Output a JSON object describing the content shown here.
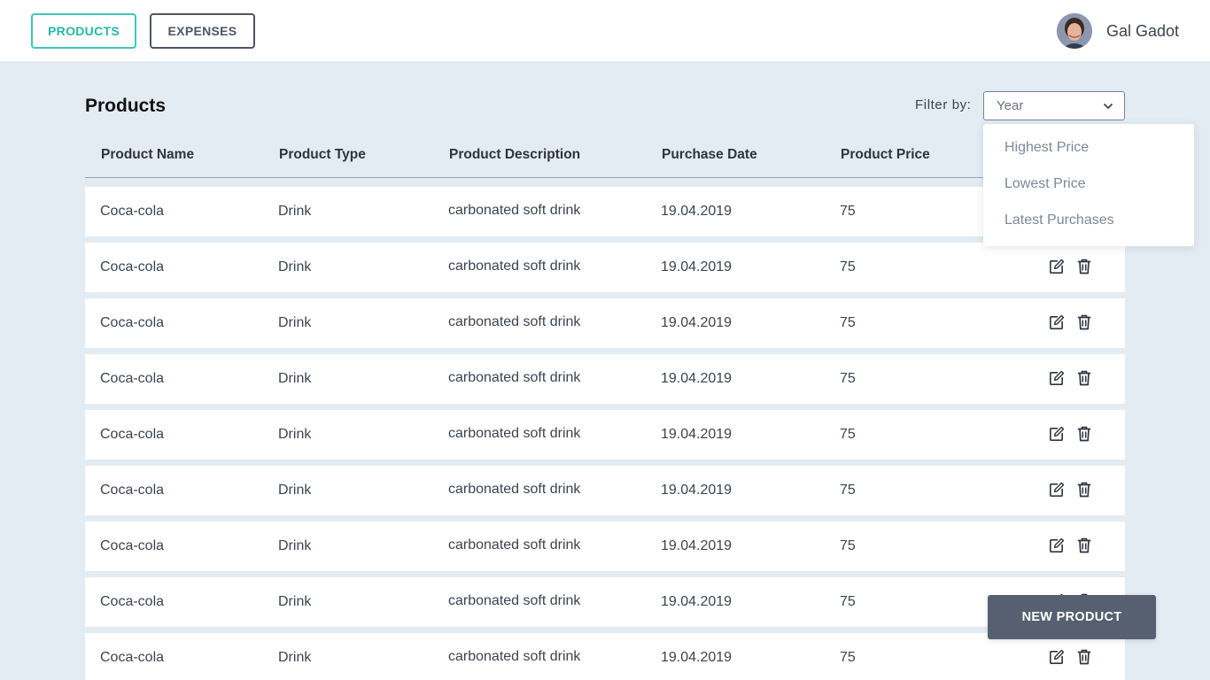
{
  "nav": {
    "products_label": "PRODUCTS",
    "expenses_label": "EXPENSES"
  },
  "user": {
    "name": "Gal Gadot"
  },
  "page": {
    "title": "Products"
  },
  "filter": {
    "label": "Filter by:",
    "selected": "Year",
    "options": [
      "Highest Price",
      "Lowest Price",
      "Latest Purchases"
    ]
  },
  "table": {
    "columns": [
      "Product Name",
      "Product Type",
      "Product Description",
      "Purchase Date",
      "Product Price"
    ],
    "rows": [
      [
        "Coca-cola",
        "Drink",
        "carbonated soft drink",
        "19.04.2019",
        "75"
      ],
      [
        "Coca-cola",
        "Drink",
        "carbonated soft drink",
        "19.04.2019",
        "75"
      ],
      [
        "Coca-cola",
        "Drink",
        "carbonated soft drink",
        "19.04.2019",
        "75"
      ],
      [
        "Coca-cola",
        "Drink",
        "carbonated soft drink",
        "19.04.2019",
        "75"
      ],
      [
        "Coca-cola",
        "Drink",
        "carbonated soft drink",
        "19.04.2019",
        "75"
      ],
      [
        "Coca-cola",
        "Drink",
        "carbonated soft drink",
        "19.04.2019",
        "75"
      ],
      [
        "Coca-cola",
        "Drink",
        "carbonated soft drink",
        "19.04.2019",
        "75"
      ],
      [
        "Coca-cola",
        "Drink",
        "carbonated soft drink",
        "19.04.2019",
        "75"
      ],
      [
        "Coca-cola",
        "Drink",
        "carbonated soft drink",
        "19.04.2019",
        "75"
      ]
    ],
    "row_icons": [
      "edit-icon",
      "trash-icon"
    ]
  },
  "new_product": {
    "label": "NEW PRODUCT"
  },
  "colors": {
    "accent": "#26b8a4",
    "background": "#e3ebf3",
    "button_dark": "#566070"
  }
}
